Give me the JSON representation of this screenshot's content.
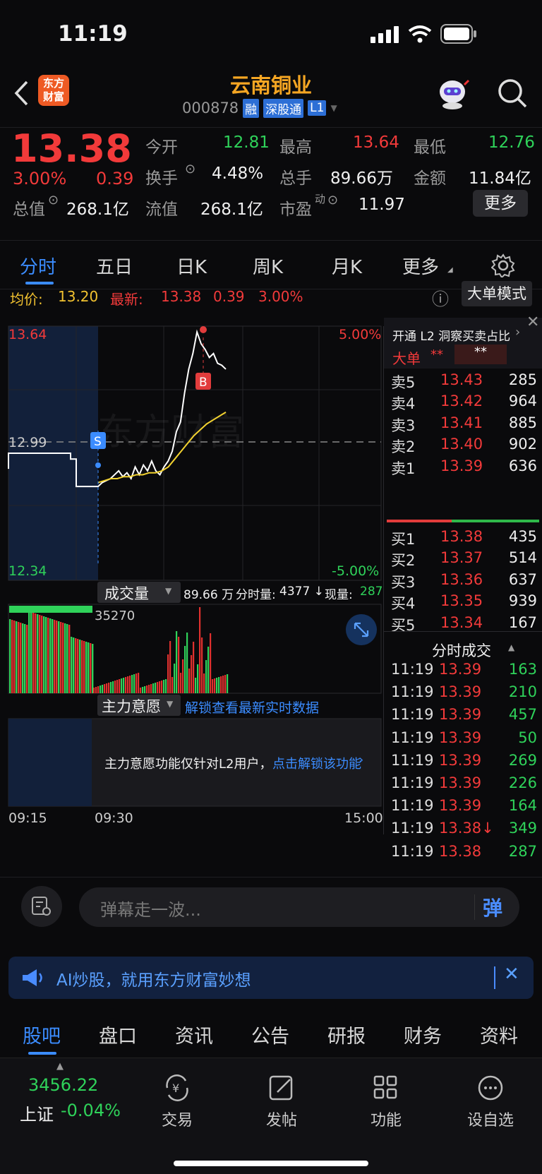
{
  "status_bar": {
    "time": "11:19"
  },
  "header": {
    "logo_line1": "东方",
    "logo_line2": "财富",
    "stock_name": "云南铜业",
    "stock_code": "000878",
    "badges": [
      "融",
      "深股通",
      "L1"
    ]
  },
  "quote": {
    "price": "13.38",
    "change_pct": "3.00%",
    "change_amt": "0.39",
    "fields": {
      "open_label": "今开",
      "open": "12.81",
      "high_label": "最高",
      "high": "13.64",
      "low_label": "最低",
      "low": "12.76",
      "turnover_label": "换手",
      "turnover": "4.48%",
      "volume_label": "总手",
      "volume": "89.66万",
      "amount_label": "金额",
      "amount": "11.84亿",
      "mktcap_label": "总值",
      "mktcap": "268.1亿",
      "float_label": "流值",
      "float": "268.1亿",
      "pe_label": "市盈",
      "pe_sup": "动",
      "pe": "11.97"
    },
    "more_label": "更多"
  },
  "tabs": [
    "分时",
    "五日",
    "日K",
    "周K",
    "月K",
    "更多"
  ],
  "active_tab": "分时",
  "chart_header": {
    "avg_label": "均价:",
    "avg": "13.20",
    "latest_label": "最新:",
    "latest": "13.38",
    "latest_amt": "0.39",
    "latest_pct": "3.00%",
    "big_order_mode": "大单模式"
  },
  "chart_labels": {
    "y_top": "13.64",
    "y_mid": "12.99",
    "y_bottom": "12.34",
    "pct_top": "5.00%",
    "pct_bottom": "-5.00%",
    "marker_s": "S",
    "marker_b": "B",
    "watermark": "东方财富",
    "time_start": "09:15",
    "time_open": "09:30",
    "time_end": "15:00"
  },
  "chart_data": {
    "type": "line",
    "x_range": [
      "09:15",
      "15:00"
    ],
    "ylim": [
      12.34,
      13.64
    ],
    "y_ref": 12.99,
    "series": [
      {
        "name": "最新",
        "values": [
          12.99,
          12.99,
          12.96,
          12.96,
          12.82,
          12.82,
          12.84,
          12.85,
          12.86,
          12.88,
          12.9,
          12.87,
          12.89,
          12.86,
          12.92,
          12.88,
          12.93,
          12.9,
          12.95,
          12.9,
          12.88,
          12.92,
          12.95,
          13.0,
          13.1,
          13.15,
          13.3,
          13.42,
          13.5,
          13.61,
          13.55,
          13.52,
          13.48,
          13.5,
          13.45,
          13.44,
          13.42
        ]
      },
      {
        "name": "均价",
        "values": [
          12.84,
          12.85,
          12.86,
          12.86,
          12.87,
          12.87,
          12.88,
          12.88,
          12.89,
          12.89,
          12.9,
          12.92,
          12.96,
          13.0,
          13.04,
          13.08,
          13.11,
          13.14,
          13.16,
          13.18,
          13.2
        ]
      }
    ]
  },
  "volume_panel": {
    "dropdown": "成交量",
    "total": "89.66 万",
    "minute_label": "分时量:",
    "minute": "4377 ↓",
    "current_label": "现量:",
    "current": "287",
    "max": "35270"
  },
  "main_force": {
    "dropdown": "主力意愿",
    "unlock": "解锁查看最新实时数据",
    "notice": "主力意愿功能仅针对L2用户，",
    "notice_link": "点击解锁该功能"
  },
  "order_book": {
    "l2_promo": "开通 L2 洞察买卖占比",
    "big_order_label": "大单",
    "big_order_val1": "**",
    "big_order_val2": "**",
    "asks": [
      {
        "label": "卖5",
        "price": "13.43",
        "vol": "285"
      },
      {
        "label": "卖4",
        "price": "13.42",
        "vol": "964"
      },
      {
        "label": "卖3",
        "price": "13.41",
        "vol": "885"
      },
      {
        "label": "卖2",
        "price": "13.40",
        "vol": "902"
      },
      {
        "label": "卖1",
        "price": "13.39",
        "vol": "636"
      }
    ],
    "bids": [
      {
        "label": "买1",
        "price": "13.38",
        "vol": "435"
      },
      {
        "label": "买2",
        "price": "13.37",
        "vol": "514"
      },
      {
        "label": "买3",
        "price": "13.36",
        "vol": "637"
      },
      {
        "label": "买4",
        "price": "13.35",
        "vol": "939"
      },
      {
        "label": "买5",
        "price": "13.34",
        "vol": "167"
      }
    ],
    "ticks_title": "分时成交",
    "ticks": [
      {
        "time": "11:19",
        "price": "13.39",
        "vol": "163"
      },
      {
        "time": "11:19",
        "price": "13.39",
        "vol": "210"
      },
      {
        "time": "11:19",
        "price": "13.39",
        "vol": "457"
      },
      {
        "time": "11:19",
        "price": "13.39",
        "vol": "50"
      },
      {
        "time": "11:19",
        "price": "13.39",
        "vol": "269"
      },
      {
        "time": "11:19",
        "price": "13.39",
        "vol": "226"
      },
      {
        "time": "11:19",
        "price": "13.39",
        "vol": "164"
      },
      {
        "time": "11:19",
        "price": "13.38↓",
        "vol": "349"
      },
      {
        "time": "11:19",
        "price": "13.38",
        "vol": "287"
      }
    ]
  },
  "danmaku": {
    "placeholder": "弹幕走一波...",
    "send": "弹"
  },
  "ai_banner": {
    "text": "AI炒股，就用东方财富妙想"
  },
  "bottom_tabs": [
    "股吧",
    "盘口",
    "资讯",
    "公告",
    "研报",
    "财务",
    "资料"
  ],
  "dock": {
    "index_value": "3456.22",
    "index_name": "上证",
    "index_change": "-0.04%",
    "items": [
      "交易",
      "发帖",
      "功能",
      "设自选"
    ]
  }
}
